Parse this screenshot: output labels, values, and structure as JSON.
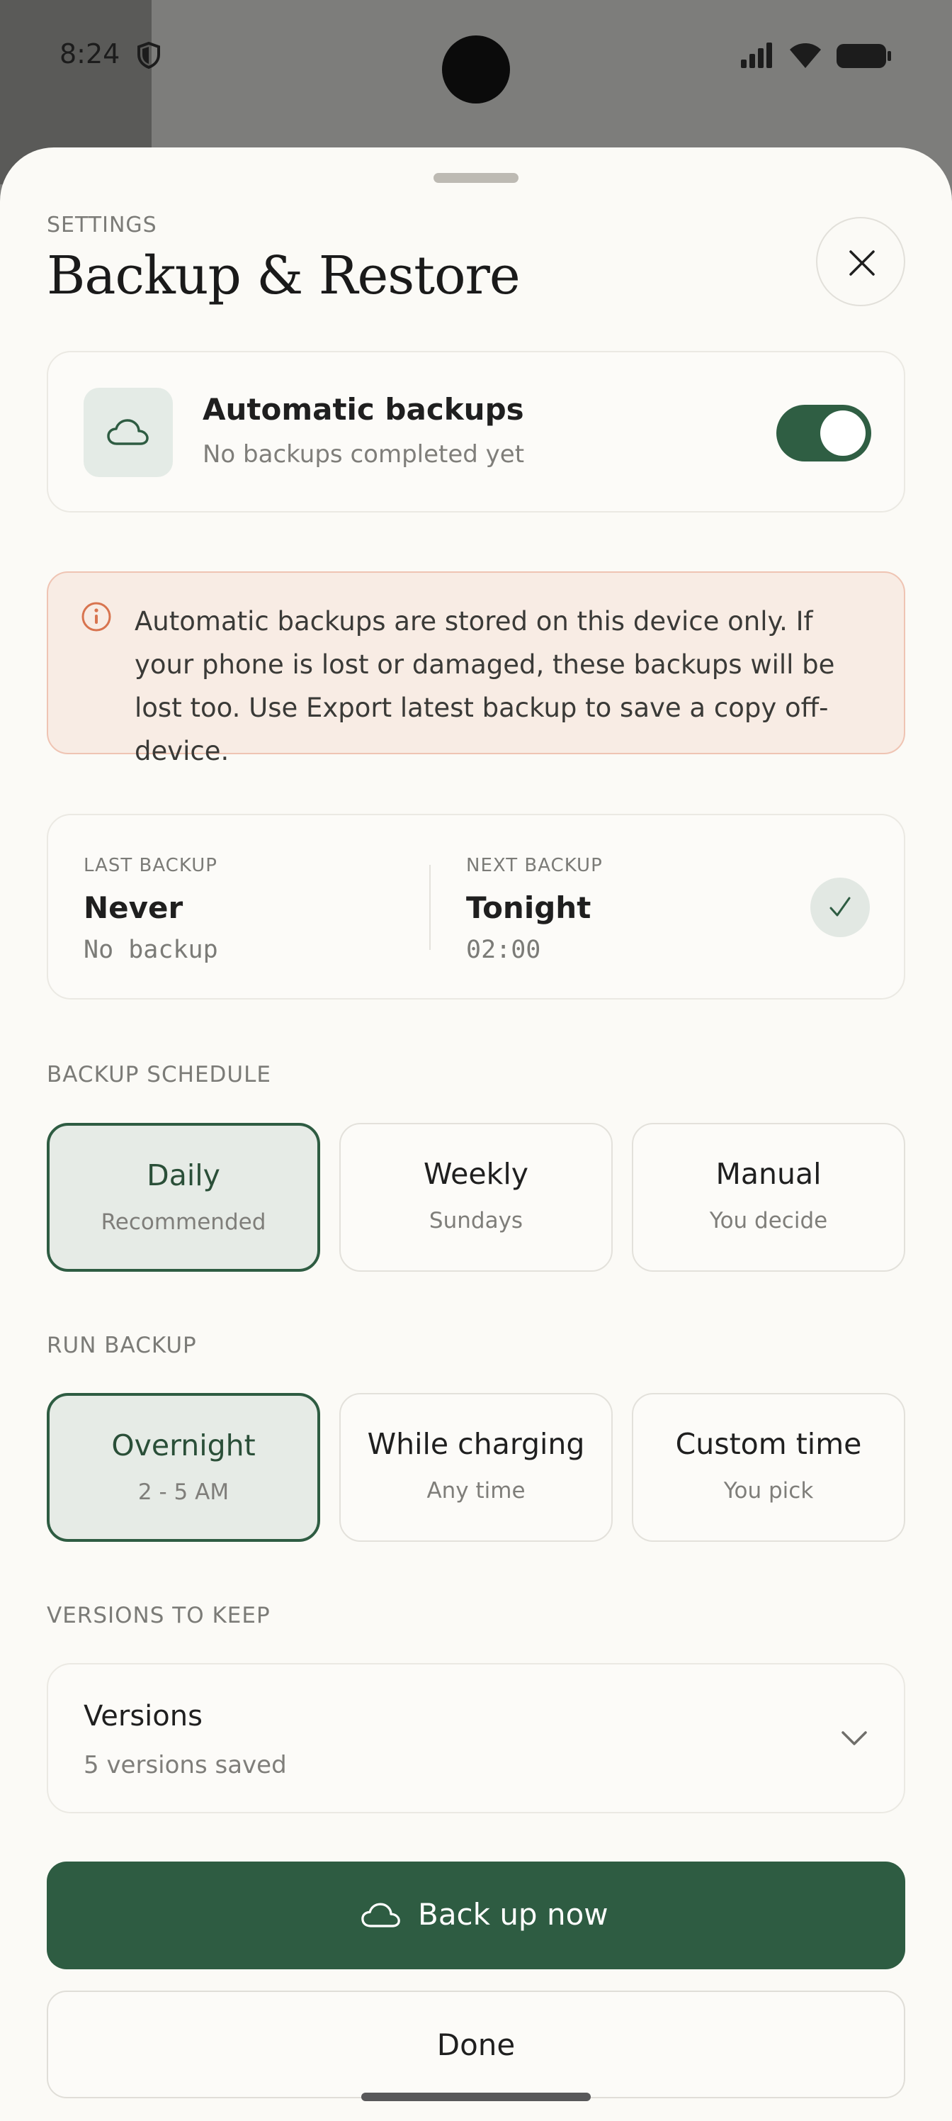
{
  "status_bar": {
    "time": "8:24",
    "icons": [
      "shield-icon",
      "signal-icon",
      "wifi-icon",
      "battery-icon"
    ]
  },
  "header": {
    "eyebrow": "SETTINGS",
    "title": "Backup & Restore",
    "close_icon": "close-icon"
  },
  "auto_backups": {
    "icon": "cloud-icon",
    "title": "Automatic backups",
    "subtitle": "No backups completed yet",
    "enabled": true
  },
  "warning": {
    "icon": "info-icon",
    "text": "Automatic backups are stored on this device only. If your phone is lost or damaged, these backups will be lost too. Use Export latest backup to save a copy off-device."
  },
  "status": {
    "last": {
      "label": "LAST BACKUP",
      "value": "Never",
      "detail": "No backup"
    },
    "next": {
      "label": "NEXT BACKUP",
      "value": "Tonight",
      "detail": "02:00"
    },
    "check_icon": "check-icon"
  },
  "schedule": {
    "label": "BACKUP SCHEDULE",
    "options": [
      {
        "title": "Daily",
        "subtitle": "Recommended",
        "selected": true
      },
      {
        "title": "Weekly",
        "subtitle": "Sundays",
        "selected": false
      },
      {
        "title": "Manual",
        "subtitle": "You decide",
        "selected": false
      }
    ]
  },
  "run": {
    "label": "RUN BACKUP",
    "options": [
      {
        "title": "Overnight",
        "subtitle": "2 - 5 AM",
        "selected": true
      },
      {
        "title": "While charging",
        "subtitle": "Any time",
        "selected": false
      },
      {
        "title": "Custom time",
        "subtitle": "You pick",
        "selected": false
      }
    ]
  },
  "versions": {
    "label": "VERSIONS TO KEEP",
    "title": "Versions",
    "subtitle": "5 versions saved",
    "icon": "chevron-down-icon"
  },
  "actions": {
    "primary_label": "Back up now",
    "primary_icon": "cloud-icon",
    "secondary_label": "Done"
  },
  "colors": {
    "accent": "#2e5c42",
    "sheet_bg": "#fbfaf6",
    "warning_bg": "#f8ece4",
    "warning_border": "#efc4b3",
    "warning_icon": "#d8744f"
  }
}
